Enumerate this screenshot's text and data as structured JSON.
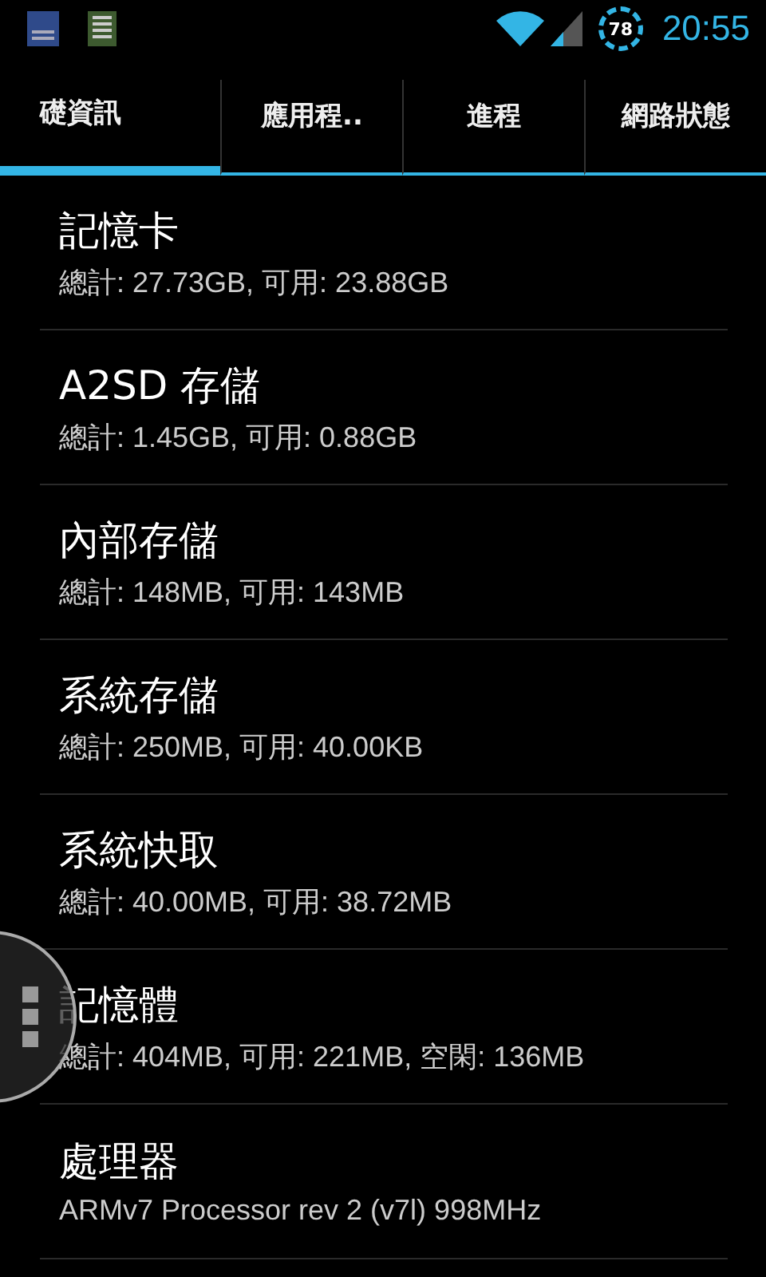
{
  "status_bar": {
    "battery_level_text": "78",
    "time": "20:55"
  },
  "tabs": [
    {
      "label": "礎資訊",
      "selected": true
    },
    {
      "label": "應用程..",
      "selected": false
    },
    {
      "label": "進程",
      "selected": false
    },
    {
      "label": "網路狀態",
      "selected": false
    }
  ],
  "items": [
    {
      "title": "記憶卡",
      "detail": "總計: 27.73GB, 可用: 23.88GB"
    },
    {
      "title": "A2SD 存儲",
      "detail": "總計: 1.45GB, 可用: 0.88GB"
    },
    {
      "title": "內部存儲",
      "detail": "總計: 148MB, 可用: 143MB"
    },
    {
      "title": "系統存儲",
      "detail": "總計: 250MB, 可用: 40.00KB"
    },
    {
      "title": "系統快取",
      "detail": "總計: 40.00MB, 可用: 38.72MB"
    },
    {
      "title": "記憶體",
      "detail": "總計: 404MB, 可用: 221MB, 空閑: 136MB"
    },
    {
      "title": "處理器",
      "detail": "ARMv7 Processor rev 2 (v7l)  998MHz"
    }
  ]
}
